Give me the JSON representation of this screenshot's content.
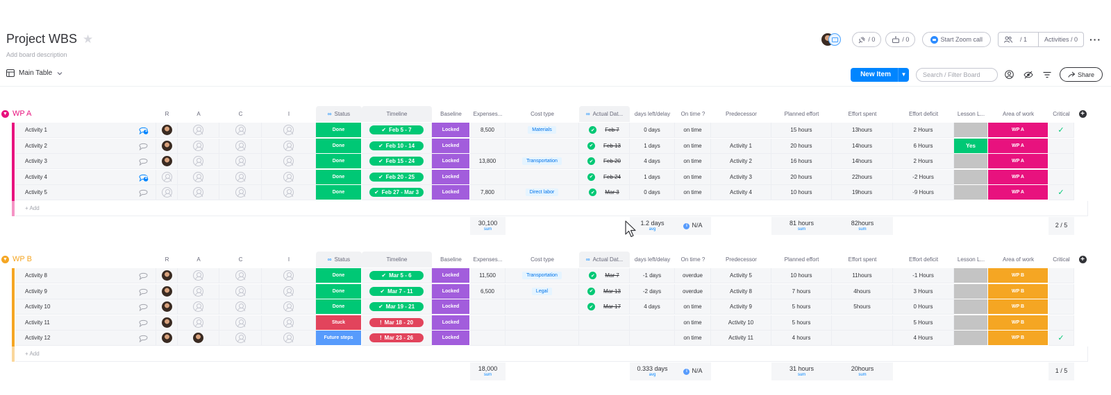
{
  "header": {
    "title": "Project WBS",
    "description": "Add board description",
    "view_label": "Main Table",
    "integrations_count": "/ 0",
    "automations_count": "/ 0",
    "zoom_label": "Start Zoom call",
    "members_count": "/ 1",
    "activities_label": "Activities / 0"
  },
  "toolbar": {
    "new_item_label": "New Item",
    "search_placeholder": "Search / Filter Board",
    "share_label": "Share"
  },
  "columns": [
    "R",
    "A",
    "C",
    "I",
    "Status",
    "Timeline",
    "Baseline",
    "Expenses...",
    "Cost type",
    "Actual Dat...",
    "days left/delay",
    "On time ?",
    "Predecessor",
    "Planned effort",
    "Effort spent",
    "Effort deficit",
    "Lesson L...",
    "Area of work",
    "Critical"
  ],
  "colors": {
    "wpa": "#e8127e",
    "wpb": "#f5a623",
    "done": "#00c875",
    "stuck": "#e2445c",
    "future": "#579bfc",
    "locked": "#a25ddc",
    "yes": "#00c875",
    "lesson_empty": "#c4c4c4"
  },
  "groups": [
    {
      "title": "WP A",
      "color": "#e8127e",
      "add_label": "+ Add",
      "rows": [
        {
          "name": "Activity 1",
          "comments": "1",
          "r": "photo",
          "a": "",
          "status": "Done",
          "timeline": "Feb 5 - 7",
          "timeline_kind": "done",
          "baseline": "Locked",
          "expenses": "8,500",
          "cost_type": "Materials",
          "actual": "Feb 7",
          "days": "0 days",
          "ontime": "on time",
          "pred": "",
          "planned": "15 hours",
          "spent": "13hours",
          "deficit": "2 Hours",
          "lesson": "",
          "area": "WP A",
          "critical": "✓"
        },
        {
          "name": "Activity 2",
          "comments": "",
          "r": "photo",
          "a": "",
          "status": "Done",
          "timeline": "Feb 10 - 14",
          "timeline_kind": "done",
          "baseline": "Locked",
          "expenses": "",
          "cost_type": "",
          "actual": "Feb 13",
          "days": "1 days",
          "ontime": "on time",
          "pred": "Activity 1",
          "planned": "20 hours",
          "spent": "14hours",
          "deficit": "6 Hours",
          "lesson": "Yes",
          "area": "WP A",
          "critical": ""
        },
        {
          "name": "Activity 3",
          "comments": "",
          "r": "photo",
          "a": "",
          "status": "Done",
          "timeline": "Feb 15 - 24",
          "timeline_kind": "done",
          "baseline": "Locked",
          "expenses": "13,800",
          "cost_type": "Transportation",
          "actual": "Feb 20",
          "days": "4 days",
          "ontime": "on time",
          "pred": "Activity 2",
          "planned": "16 hours",
          "spent": "14hours",
          "deficit": "2 Hours",
          "lesson": "",
          "area": "WP A",
          "critical": ""
        },
        {
          "name": "Activity 4",
          "comments": "2",
          "r": "",
          "a": "",
          "status": "Done",
          "timeline": "Feb 20 - 25",
          "timeline_kind": "done",
          "baseline": "Locked",
          "expenses": "",
          "cost_type": "",
          "actual": "Feb 24",
          "days": "1 days",
          "ontime": "on time",
          "pred": "Activity 3",
          "planned": "20 hours",
          "spent": "22hours",
          "deficit": "-2 Hours",
          "lesson": "",
          "area": "WP A",
          "critical": ""
        },
        {
          "name": "Activity 5",
          "comments": "",
          "r": "",
          "a": "",
          "status": "Done",
          "timeline": "Feb 27 - Mar 3",
          "timeline_kind": "done",
          "baseline": "Locked",
          "expenses": "7,800",
          "cost_type": "Direct labor",
          "actual": "Mar 3",
          "days": "0 days",
          "ontime": "on time",
          "pred": "Activity 4",
          "planned": "10 hours",
          "spent": "19hours",
          "deficit": "-9 Hours",
          "lesson": "",
          "area": "WP A",
          "critical": "✓"
        }
      ],
      "summary": {
        "expenses": "30,100",
        "expenses_fn": "sum",
        "days": "1.2 days",
        "days_fn": "avg",
        "ontime": "N/A",
        "planned": "81 hours",
        "planned_fn": "sum",
        "spent": "82hours",
        "spent_fn": "sum",
        "critical": "2 / 5"
      }
    },
    {
      "title": "WP B",
      "color": "#f5a623",
      "add_label": "+ Add",
      "rows": [
        {
          "name": "Activity 8",
          "comments": "",
          "r": "photo",
          "a": "",
          "status": "Done",
          "timeline": "Mar 5 - 6",
          "timeline_kind": "done",
          "baseline": "Locked",
          "expenses": "11,500",
          "cost_type": "Transportation",
          "actual": "Mar 7",
          "days": "-1 days",
          "ontime": "overdue",
          "pred": "Activity 5",
          "planned": "10 hours",
          "spent": "11hours",
          "deficit": "-1 Hours",
          "lesson": "",
          "area": "WP B",
          "critical": ""
        },
        {
          "name": "Activity 9",
          "comments": "",
          "r": "photo",
          "a": "",
          "status": "Done",
          "timeline": "Mar 7 - 11",
          "timeline_kind": "done",
          "baseline": "Locked",
          "expenses": "6,500",
          "cost_type": "Legal",
          "actual": "Mar 13",
          "days": "-2 days",
          "ontime": "overdue",
          "pred": "Activity 8",
          "planned": "7 hours",
          "spent": "4hours",
          "deficit": "3 Hours",
          "lesson": "",
          "area": "WP B",
          "critical": ""
        },
        {
          "name": "Activity 10",
          "comments": "",
          "r": "photo",
          "a": "",
          "status": "Done",
          "timeline": "Mar 19 - 21",
          "timeline_kind": "done",
          "baseline": "Locked",
          "expenses": "",
          "cost_type": "",
          "actual": "Mar 17",
          "days": "4 days",
          "ontime": "on time",
          "pred": "Activity 9",
          "planned": "5 hours",
          "spent": "5hours",
          "deficit": "0 Hours",
          "lesson": "",
          "area": "WP B",
          "critical": ""
        },
        {
          "name": "Activity 11",
          "comments": "",
          "r": "photo",
          "a": "",
          "status": "Stuck",
          "timeline": "Mar 18 - 20",
          "timeline_kind": "stuck",
          "baseline": "Locked",
          "expenses": "",
          "cost_type": "",
          "actual": "",
          "days": "",
          "ontime": "on time",
          "pred": "Activity 10",
          "planned": "5 hours",
          "spent": "",
          "deficit": "5 Hours",
          "lesson": "",
          "area": "WP B",
          "critical": ""
        },
        {
          "name": "Activity 12",
          "comments": "",
          "r": "photo",
          "a": "photo",
          "status": "Future steps",
          "timeline": "Mar 23 - 26",
          "timeline_kind": "stuck",
          "baseline": "Locked",
          "expenses": "",
          "cost_type": "",
          "actual": "",
          "days": "",
          "ontime": "on time",
          "pred": "Activity 11",
          "planned": "4 hours",
          "spent": "",
          "deficit": "4 Hours",
          "lesson": "",
          "area": "WP B",
          "critical": "✓"
        }
      ],
      "summary": {
        "expenses": "18,000",
        "expenses_fn": "sum",
        "days": "0.333 days",
        "days_fn": "avg",
        "ontime": "N/A",
        "planned": "31 hours",
        "planned_fn": "sum",
        "spent": "20hours",
        "spent_fn": "sum",
        "critical": "1 / 5"
      }
    }
  ]
}
